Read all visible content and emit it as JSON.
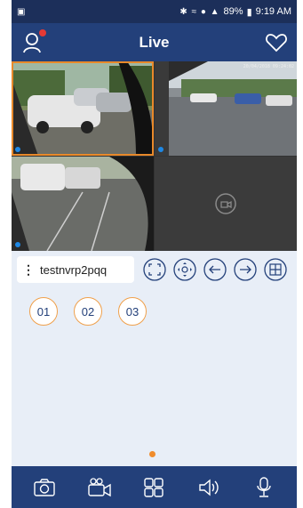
{
  "status_bar": {
    "time": "9:19 AM",
    "battery": "89%",
    "left_icon": "gallery-icon",
    "system_icons": "bluetooth wifi signal"
  },
  "header": {
    "title": "Live",
    "left_icon": "user-icon",
    "right_icon": "heart-icon"
  },
  "grid": {
    "tiles": [
      {
        "name": "camera-tile-1",
        "selected": true,
        "has_feed": true
      },
      {
        "name": "camera-tile-2",
        "selected": false,
        "has_feed": true,
        "timestamp": "20/04/2018 09:24:02"
      },
      {
        "name": "camera-tile-3",
        "selected": false,
        "has_feed": true
      },
      {
        "name": "camera-tile-4",
        "selected": false,
        "has_feed": false,
        "icon": "add-camera-icon"
      }
    ]
  },
  "device": {
    "name": "testnvrp2pqq",
    "menu_icon": "kebab-icon",
    "controls": [
      "fullscreen-icon",
      "ptz-icon",
      "arrow-left-icon",
      "arrow-right-icon",
      "layout-icon"
    ]
  },
  "channels": [
    "01",
    "02",
    "03"
  ],
  "toolbar": {
    "items": [
      "camera-icon",
      "record-icon",
      "grid-icon",
      "speaker-icon",
      "microphone-icon"
    ]
  },
  "colors": {
    "header_bg": "#23407a",
    "accent": "#f08c2c",
    "selected_border": "#e8892a",
    "panel_bg": "#e8eef7"
  }
}
